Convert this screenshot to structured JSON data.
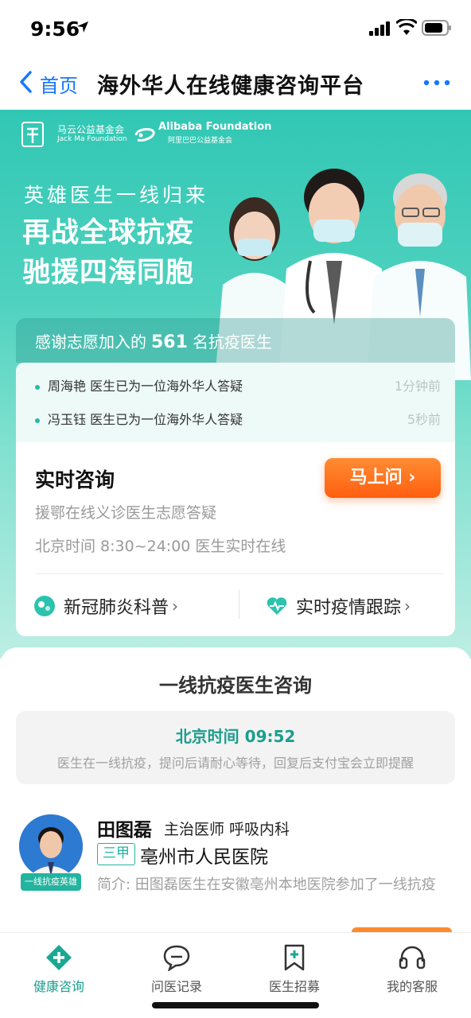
{
  "status_bar": {
    "time": "9:56"
  },
  "navbar": {
    "back_label": "首页",
    "title": "海外华人在线健康咨询平台"
  },
  "hero": {
    "logo_jackma_cn": "马云公益基金会",
    "logo_jackma_en": "Jack Ma Foundation",
    "logo_alibaba_en": "Alibaba Foundation",
    "logo_alibaba_cn": "阿里巴巴公益基金会",
    "subtitle": "英雄医生一线归来",
    "headline_1": "再战全球抗疫",
    "headline_2": "驰援四海同胞",
    "thanks_prefix": "感谢志愿加入的",
    "thanks_count": "561",
    "thanks_suffix": "名抗疫医生"
  },
  "ticker": [
    {
      "text": "周海艳 医生已为一位海外华人答疑",
      "ago": "1分钟前"
    },
    {
      "text": "冯玉钰 医生已为一位海外华人答疑",
      "ago": "5秒前"
    }
  ],
  "consult_card": {
    "title": "实时咨询",
    "ask_button": "马上问 ›",
    "line1": "援鄂在线义诊医生志愿答疑",
    "line2": "北京时间 8:30~24:00 医生实时在线",
    "link_left": "新冠肺炎科普",
    "link_right": "实时疫情跟踪",
    "chev": "›"
  },
  "doctors_section": {
    "title": "一线抗疫医生咨询",
    "notice_time": "北京时间  09:52",
    "notice_msg": "医生在一线抗疫，提问后请耐心等待，回复后支付宝会立即提醒"
  },
  "doctor": {
    "badge": "一线抗疫英雄",
    "name": "田图磊",
    "title": "主治医师 呼吸内科",
    "grade": "三甲",
    "hospital": "亳州市人民医院",
    "intro": "简介: 田图磊医生在安徽亳州本地医院参加了一线抗疫"
  },
  "tabbar": {
    "tabs": [
      {
        "label": "健康咨询",
        "icon": "health-consult-icon"
      },
      {
        "label": "问医记录",
        "icon": "chat-record-icon"
      },
      {
        "label": "医生招募",
        "icon": "recruit-bookmark-icon"
      },
      {
        "label": "我的客服",
        "icon": "headset-icon"
      }
    ],
    "active_index": 0
  },
  "colors": {
    "accent": "#1a9e8c",
    "brand_blue": "#1677ff",
    "cta_orange": "#ff6a1a",
    "hero_teal": "#31c7b4"
  }
}
